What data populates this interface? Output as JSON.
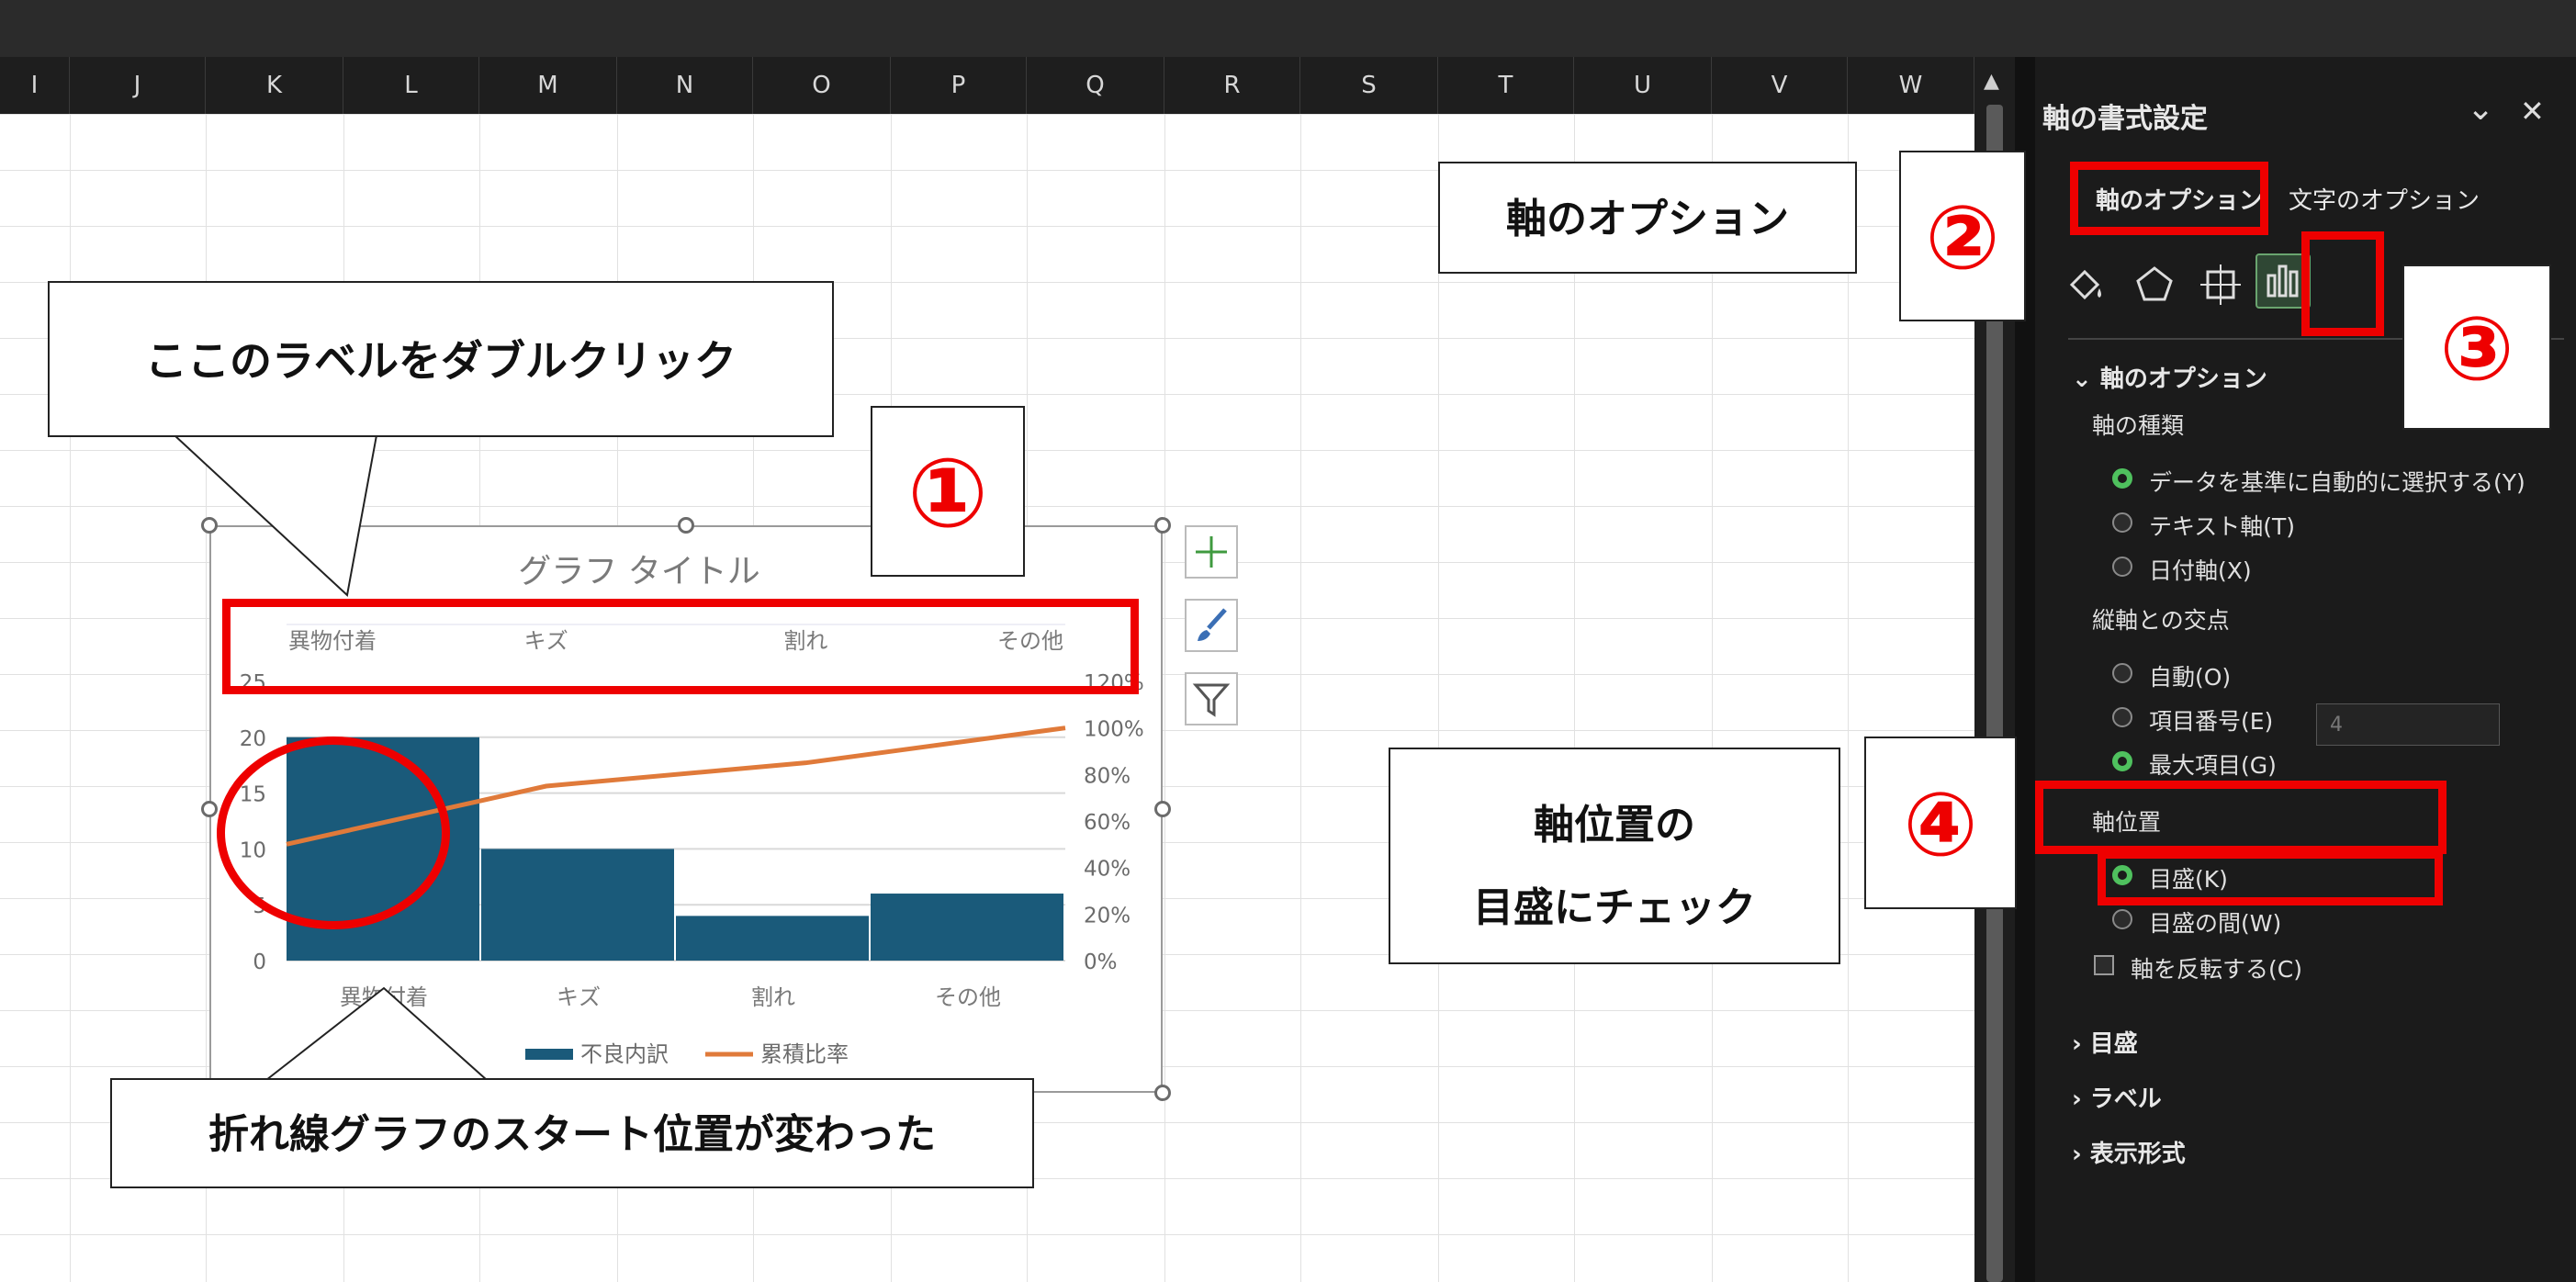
{
  "columns": [
    "I",
    "J",
    "K",
    "L",
    "M",
    "N",
    "O",
    "P",
    "Q",
    "R",
    "S",
    "T",
    "U",
    "V",
    "W"
  ],
  "pane": {
    "title": "軸の書式設定",
    "tabs": [
      "軸のオプション",
      "文字のオプション"
    ],
    "section_axis_options": "軸のオプション",
    "axis_type_label": "軸の種類",
    "axis_type_options": [
      "データを基準に自動的に選択する(Y)",
      "テキスト軸(T)",
      "日付軸(X)"
    ],
    "cross_label": "縦軸との交点",
    "cross_options": [
      "自動(O)",
      "項目番号(E)",
      "最大項目(G)"
    ],
    "cross_number": "4",
    "axis_position_label": "軸位置",
    "axis_position_options": [
      "目盛(K)",
      "目盛の間(W)"
    ],
    "reverse_label": "軸を反転する(C)",
    "collapsed_sections": [
      "目盛",
      "ラベル",
      "表示形式"
    ]
  },
  "chart_data": {
    "type": "bar",
    "title": "グラフ タイトル",
    "categories": [
      "異物付着",
      "キズ",
      "割れ",
      "その他"
    ],
    "top_axis_categories": [
      "異物付着",
      "キズ",
      "割れ",
      "その他"
    ],
    "series": [
      {
        "name": "不良内訳",
        "kind": "bar",
        "values": [
          20,
          10,
          4,
          6
        ],
        "color": "#1a5a7a"
      },
      {
        "name": "累積比率",
        "kind": "line",
        "axis": "secondary",
        "values": [
          0.5,
          0.75,
          0.85,
          1.0
        ],
        "color": "#e07a3a"
      }
    ],
    "y_ticks": [
      "0",
      "5",
      "10",
      "15",
      "20",
      "25"
    ],
    "y_range": [
      0,
      25
    ],
    "y2_ticks": [
      "0%",
      "20%",
      "40%",
      "60%",
      "80%",
      "100%",
      "120%"
    ],
    "y2_range": [
      0,
      1.2
    ],
    "legend_position": "bottom",
    "grid": true
  },
  "callouts": {
    "double_click": "ここのラベルをダブルクリック",
    "line_start": "折れ線グラフのスタート位置が変わった",
    "axis_options": "軸のオプション",
    "axis_position_line1": "軸位置の",
    "axis_position_line2": "目盛にチェック"
  },
  "steps": [
    "①",
    "②",
    "③",
    "④"
  ],
  "colors": {
    "accent_red": "#ee0000",
    "bar": "#1a5a7a",
    "line": "#e07a3a",
    "radio_on": "#4fc15e"
  },
  "icons": [
    "fill-line-icon",
    "effects-pentagon-icon",
    "size-properties-icon",
    "bar-chart-options-icon",
    "chart-elements-plus-icon",
    "chart-styles-brush-icon",
    "chart-filter-icon"
  ]
}
